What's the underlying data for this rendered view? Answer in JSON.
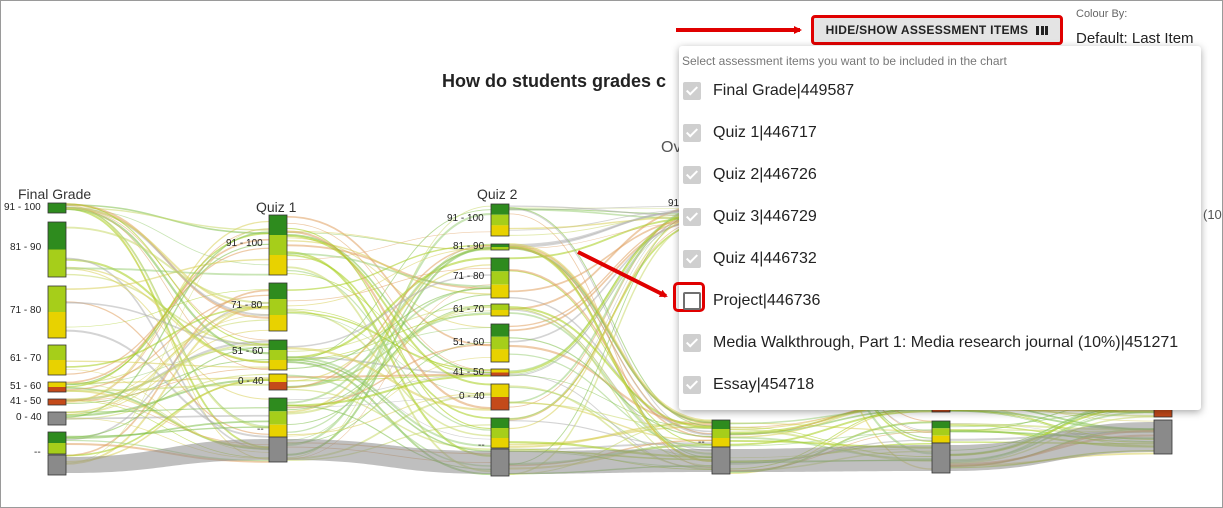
{
  "header": {
    "title": "How do students grades c",
    "subtitle": "Ov",
    "hide_show_button": "HIDE/SHOW ASSESSMENT ITEMS",
    "colour_by_label": "Colour By:",
    "colour_by_value": "Default: Last Item"
  },
  "dropdown": {
    "hint": "Select assessment items you want to be included in the chart",
    "items": [
      {
        "label": "Final Grade|449587",
        "checked": true
      },
      {
        "label": "Quiz 1|446717",
        "checked": true
      },
      {
        "label": "Quiz 2|446726",
        "checked": true
      },
      {
        "label": "Quiz 3|446729",
        "checked": true
      },
      {
        "label": "Quiz 4|446732",
        "checked": true
      },
      {
        "label": "Project|446736",
        "checked": false
      },
      {
        "label": "Media Walkthrough, Part 1: Media research journal (10%)|451271",
        "checked": true
      },
      {
        "label": "Essay|454718",
        "checked": true
      }
    ]
  },
  "axes": [
    {
      "name": "Final Grade",
      "bands": [
        "91 - 100",
        "81 - 90",
        "71 - 80",
        "61 - 70",
        "51 - 60",
        "41 - 50",
        "0 - 40",
        "--"
      ]
    },
    {
      "name": "Quiz 1",
      "bands": [
        "91 - 100",
        "71 - 80",
        "51 - 60",
        "0 - 40",
        "--"
      ]
    },
    {
      "name": "Quiz 2",
      "bands": [
        "91 - 100",
        "81 - 90",
        "71 - 80",
        "61 - 70",
        "51 - 60",
        "41 - 50",
        "0 - 40",
        "--"
      ]
    }
  ],
  "axis_fragments": {
    "axis4_top": "91",
    "axis4_bottom": "--",
    "right_edge": "(10"
  },
  "colors": {
    "annotation_red": "#e00000",
    "grade_high": "#2e8b1e",
    "grade_mid": "#a6ce1a",
    "grade_low": "#e8d200",
    "grade_fail": "#c44a1a",
    "no_grade": "#8a8a8a"
  }
}
